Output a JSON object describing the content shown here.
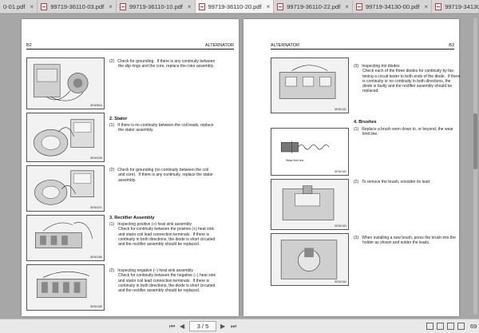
{
  "tabs": [
    {
      "label": "0-01.pdf",
      "close": "×"
    },
    {
      "label": "99719-36110-03.pdf",
      "close": "×"
    },
    {
      "label": "99719-36110-10.pdf",
      "close": "×"
    },
    {
      "label": "99719-36110-20.pdf",
      "close": "×"
    },
    {
      "label": "99719-36110-22.pdf",
      "close": "×"
    },
    {
      "label": "99719-34130-00.pdf",
      "close": "×"
    },
    {
      "label": "99719-34130-01.pdf",
      "close": "×"
    },
    {
      "label": "99719-36110-00.pdf",
      "close": "×"
    }
  ],
  "active_tab": 3,
  "left_page": {
    "page_no": "B2",
    "header": "ALTERNATOR",
    "figures": [
      "8EN0804",
      "8EN0208",
      "8EN0201",
      "8EN0186",
      "8EN0185"
    ],
    "item_rotor_2": "(2)   Check for grounding.  If there is any continuity between\n        the slip rings and the core, replace the rotor assembly.",
    "section_stator": "2.  Stator",
    "stator_1": "(1)   If there is no continuity between the coil leads, replace\n        the stator assembly.",
    "stator_2": "(2)   Check for grounding (no continuity between the coil\n        and core).  If there is any continuity, replace the stator\n        assembly.",
    "section_rectifier": "3.  Rectifier Assembly",
    "rect_1": "(1)   Inspecting positive (+) heat sink assembly\n        Check for continuity between the positive (+) heat sink\n        and stator coil lead connection terminals.  If there is\n        continuity in both directions, the diode is short circuited\n        and the rectifier assembly should be replaced.",
    "rect_2": "(2)   Inspecting negative (−) heat sink assembly\n        Check for continuity between the negative (−) heat sink\n        and stator coil lead connection terminals.  If there is\n        continuity in both directions, the diode is short circuited\n        and the rectifier assembly should be replaced."
  },
  "right_page": {
    "page_no": "B3",
    "header": "ALTERNATOR",
    "figures": [
      "8EN0181",
      "8EN0182",
      "8EN0183",
      "8EN0184"
    ],
    "brush_label": "Wear limit line",
    "diodes_3": "(3)   Inspecting trio diodes\n        Check each of the three diodes for continuity by fas-\n        tening a circuit tester to both ends of the diode.  If there\n        is continuity or no continuity in both directions, the\n        diode is faulty and the rectifier assembly should be\n        replaced.",
    "section_brushes": "4.  Brushes",
    "brush_1": "(1)   Replace a brush worn down to, or beyond, the wear\n        limit line.",
    "brush_2": "(2)   To remove the brush, unsolder its lead.",
    "brush_3": "(3)   When installing a new brush, press the brush into the\n        holder as shown and solder the leads."
  },
  "toolbar": {
    "page_indicator": "3 / 5",
    "zoom": "69",
    "first": "⏮",
    "prev": "◀",
    "next": "▶",
    "last": "⏭"
  }
}
